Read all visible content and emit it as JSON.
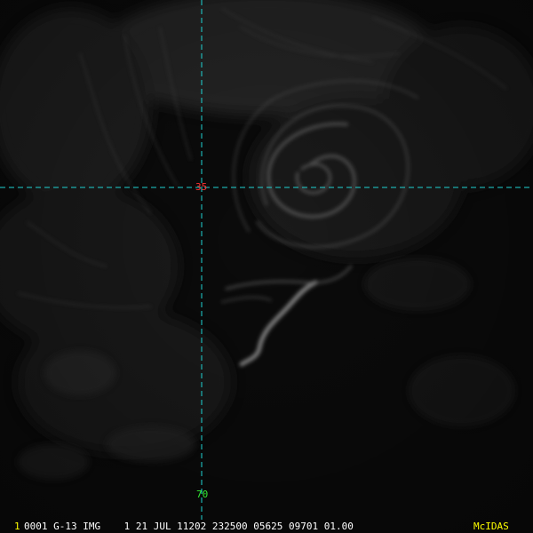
{
  "grid": {
    "latitude_label": "35",
    "longitude_label": "70",
    "line_color": "#1fd3d3"
  },
  "status_bar": {
    "frame_number": "1",
    "text": "0001 G-13 IMG    1 21 JUL 11202 232500 05625 09701 01.00",
    "brand": "McIDAS"
  },
  "colors": {
    "background": "#0b0b0b",
    "lat_label": "#ff3030",
    "lon_label": "#33ee33",
    "frame_number": "#ffff00",
    "status_text": "#ffffff",
    "brand": "#ffff00"
  }
}
